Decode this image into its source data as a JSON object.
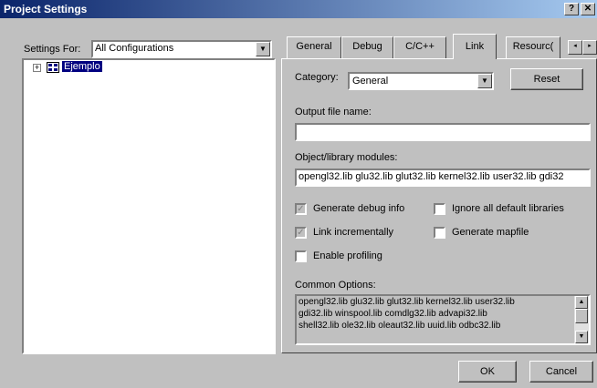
{
  "window": {
    "title": "Project Settings",
    "help_label": "?",
    "close_label": "✕"
  },
  "settings_for": {
    "label": "Settings For:",
    "value": "All Configurations"
  },
  "tree": {
    "expander": "+",
    "project_name": "Ejemplo"
  },
  "tabs": [
    {
      "label": "General"
    },
    {
      "label": "Debug"
    },
    {
      "label": "C/C++"
    },
    {
      "label": "Link"
    },
    {
      "label": "Resourc("
    }
  ],
  "tab_scroll": {
    "left": "◂",
    "right": "▸"
  },
  "link": {
    "category_label": "Category:",
    "category_value": "General",
    "reset_label": "Reset",
    "output_file_label": "Output file name:",
    "output_file_value": "",
    "object_modules_label": "Object/library modules:",
    "object_modules_value": "opengl32.lib glu32.lib glut32.lib kernel32.lib user32.lib gdi32",
    "checkboxes": [
      {
        "label": "Generate debug info",
        "checked": true,
        "mark": "✓"
      },
      {
        "label": "Ignore all default libraries",
        "checked": false,
        "mark": ""
      },
      {
        "label": "Link incrementally",
        "checked": true,
        "mark": "✓"
      },
      {
        "label": "Generate mapfile",
        "checked": false,
        "mark": ""
      },
      {
        "label": "Enable profiling",
        "checked": false,
        "mark": ""
      }
    ],
    "common_options_label": "Common Options:",
    "common_options_lines": [
      "opengl32.lib glu32.lib glut32.lib kernel32.lib user32.lib",
      "gdi32.lib winspool.lib comdlg32.lib advapi32.lib",
      "shell32.lib ole32.lib oleaut32.lib uuid.lib odbc32.lib"
    ]
  },
  "buttons": {
    "ok_label": "OK",
    "cancel_label": "Cancel"
  }
}
